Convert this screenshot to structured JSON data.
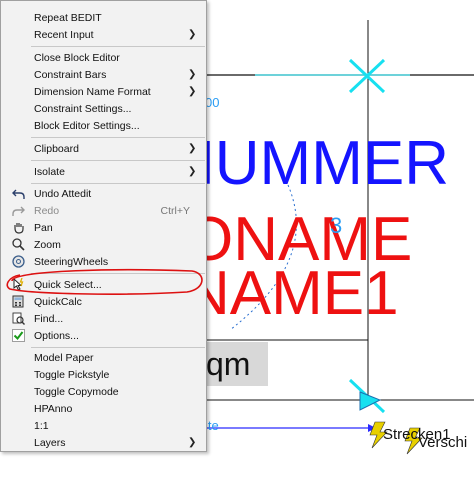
{
  "drawing": {
    "texts": {
      "nummer": "HUMMER",
      "name": "ONAME",
      "name1": "NAME1",
      "qm": "qm",
      "strecken": "Strecken1",
      "versch": "Verschi",
      "ite": "ite",
      "dim00": "00",
      "three": "3"
    },
    "colors": {
      "blue_text": "#1414ff",
      "red_text": "#ee1111",
      "cyan_markers": "#17e0f0",
      "selection_highlight": "#2a9df4"
    }
  },
  "context_menu": {
    "items": [
      {
        "label": "Repeat BEDIT"
      },
      {
        "label": "Recent Input",
        "submenu": true
      },
      {
        "label": "Close Block Editor"
      },
      {
        "label": "Constraint Bars",
        "submenu": true
      },
      {
        "label": "Dimension Name Format",
        "submenu": true
      },
      {
        "label": "Constraint Settings..."
      },
      {
        "label": "Block Editor Settings..."
      },
      {
        "label": "Clipboard",
        "submenu": true
      },
      {
        "label": "Isolate",
        "submenu": true
      },
      {
        "label": "Undo Attedit",
        "icon": "undo-icon"
      },
      {
        "label": "Redo",
        "shortcut": "Ctrl+Y",
        "icon": "redo-icon",
        "disabled": true
      },
      {
        "label": "Pan",
        "icon": "pan-icon"
      },
      {
        "label": "Zoom",
        "icon": "zoom-icon"
      },
      {
        "label": "SteeringWheels",
        "icon": "steering-wheel-icon"
      },
      {
        "label": "Quick Select...",
        "icon": "quick-select-icon"
      },
      {
        "label": "QuickCalc",
        "icon": "calculator-icon"
      },
      {
        "label": "Find...",
        "icon": "find-icon"
      },
      {
        "label": "Options...",
        "icon": "checkmark-icon"
      },
      {
        "label": "Model Paper"
      },
      {
        "label": "Toggle Pickstyle"
      },
      {
        "label": "Toggle Copymode"
      },
      {
        "label": "HPAnno"
      },
      {
        "label": "1:1"
      },
      {
        "label": "Layers",
        "submenu": true
      }
    ],
    "highlighted_item": "Quick Select...",
    "annotation_color": "#dd1111"
  }
}
